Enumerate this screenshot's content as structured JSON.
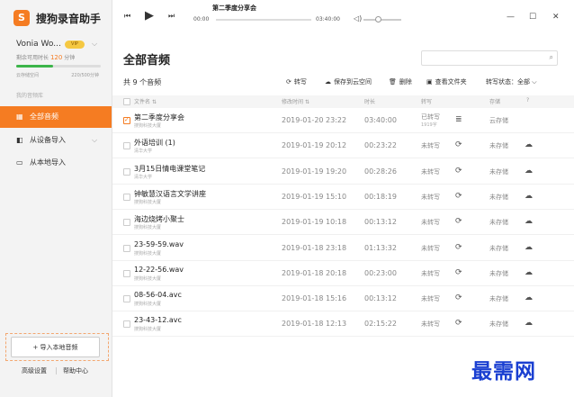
{
  "app": {
    "logo_glyph": "S",
    "name": "搜狗录音助手"
  },
  "user": {
    "name": "Vonia Wo...",
    "vip_badge": "VIP",
    "remain_label": "剩余可用时长",
    "remain_value": "120",
    "remain_unit": "分钟",
    "storage_label": "云存储空间",
    "storage_value": "220/500分钟",
    "storage_progress": 0.44
  },
  "sidebar": {
    "section_label": "我的音频库",
    "items": [
      {
        "icon": "grid-icon",
        "glyph": "▦",
        "label": "全部音频",
        "active": true
      },
      {
        "icon": "device-icon",
        "glyph": "◧",
        "label": "从设备导入",
        "active": false
      },
      {
        "icon": "monitor-icon",
        "glyph": "▭",
        "label": "从本地导入",
        "active": false
      }
    ],
    "import_button": "+ 导入本地音频",
    "footer": {
      "settings": "高级设置",
      "help": "帮助中心"
    }
  },
  "player": {
    "title": "第二季度分享会",
    "time_current": "00:00",
    "time_total": "03:40:00",
    "volume_level": 0.31
  },
  "main": {
    "title": "全部音频",
    "count_label": "共 9 个音频",
    "actions": [
      {
        "icon": "transcribe-icon",
        "glyph": "⟳",
        "label": "转写"
      },
      {
        "icon": "cloud-save-icon",
        "glyph": "☁",
        "label": "保存到云空间"
      },
      {
        "icon": "delete-icon",
        "glyph": "🗑",
        "label": "删除"
      },
      {
        "icon": "folder-icon",
        "glyph": "▣",
        "label": "查看文件夹"
      }
    ],
    "status_filter_label": "转写状态：",
    "status_filter_value": "全部",
    "columns": {
      "name": "文件名",
      "modified": "修改时间",
      "duration": "时长",
      "transcribe": "转写",
      "storage": "存储"
    },
    "rows": [
      {
        "name": "第二季度分享会",
        "source": "搜狗科技大厦",
        "date": "2019-01-20  23:22",
        "duration": "03:40:00",
        "transcribe": "已转写",
        "transcribe_sub": "1919字",
        "storage": "云存储",
        "checked": true,
        "trans_icon": "≣",
        "cloud_icon": ""
      },
      {
        "name": "外语培训 (1)",
        "source": "清华大学",
        "date": "2019-01-19  20:12",
        "duration": "00:23:22",
        "transcribe": "未转写",
        "storage": "未存储",
        "checked": false,
        "trans_icon": "⟳",
        "cloud_icon": "☁"
      },
      {
        "name": "3月15日情电课堂笔记",
        "source": "清华大学",
        "date": "2019-01-19  19:20",
        "duration": "00:28:26",
        "transcribe": "未转写",
        "storage": "未存储",
        "checked": false,
        "trans_icon": "⟳",
        "cloud_icon": "☁"
      },
      {
        "name": "钟敏慧汉语言文学讲座",
        "source": "搜狗科技大厦",
        "date": "2019-01-19  15:10",
        "duration": "00:18:19",
        "transcribe": "未转写",
        "storage": "未存储",
        "checked": false,
        "trans_icon": "⟳",
        "cloud_icon": "☁"
      },
      {
        "name": "海边烧烤小聚士",
        "source": "搜狗科技大厦",
        "date": "2019-01-19  10:18",
        "duration": "00:13:12",
        "transcribe": "未转写",
        "storage": "未存储",
        "checked": false,
        "trans_icon": "⟳",
        "cloud_icon": "☁"
      },
      {
        "name": "23-59-59.wav",
        "source": "搜狗科技大厦",
        "date": "2019-01-18  23:18",
        "duration": "01:13:32",
        "transcribe": "未转写",
        "storage": "未存储",
        "checked": false,
        "trans_icon": "⟳",
        "cloud_icon": "☁"
      },
      {
        "name": "12-22-56.wav",
        "source": "搜狗科技大厦",
        "date": "2019-01-18  20:18",
        "duration": "00:23:00",
        "transcribe": "未转写",
        "storage": "未存储",
        "checked": false,
        "trans_icon": "⟳",
        "cloud_icon": "☁"
      },
      {
        "name": "08-56-04.avc",
        "source": "搜狗科技大厦",
        "date": "2019-01-18  15:16",
        "duration": "00:13:12",
        "transcribe": "未转写",
        "storage": "未存储",
        "checked": false,
        "trans_icon": "⟳",
        "cloud_icon": "☁"
      },
      {
        "name": "23-43-12.avc",
        "source": "搜狗科技大厦",
        "date": "2019-01-18  12:13",
        "duration": "02:15:22",
        "transcribe": "未转写",
        "storage": "未存储",
        "checked": false,
        "trans_icon": "⟳",
        "cloud_icon": "☁"
      }
    ]
  },
  "watermark": "最需网",
  "colors": {
    "accent": "#f57c22",
    "progress": "#3cb54a",
    "watermark": "#1a3fd1"
  }
}
